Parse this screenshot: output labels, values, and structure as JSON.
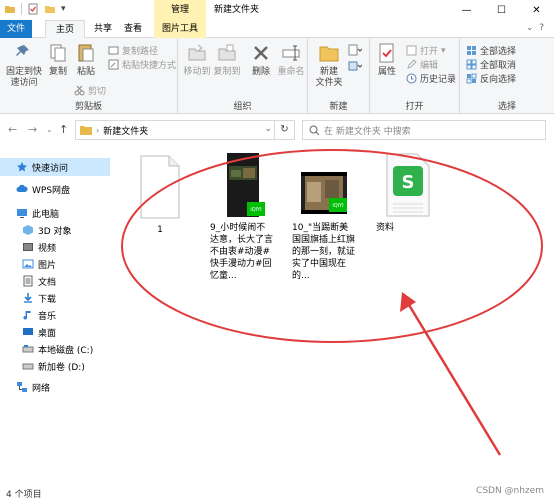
{
  "window": {
    "title": "新建文件夹",
    "manage_tab": "管理",
    "minimize": "—",
    "maximize": "☐",
    "close": "✕"
  },
  "tabs": {
    "file": "文件",
    "home": "主页",
    "share": "共享",
    "view": "查看",
    "picture_tools": "图片工具"
  },
  "ribbon": {
    "pin_quick_access": "固定到快\n速访问",
    "copy": "复制",
    "paste": "粘贴",
    "copy_path": "复制路径",
    "paste_shortcut": "粘贴快捷方式",
    "cut": "剪切",
    "clipboard": "剪贴板",
    "move_to": "移动到",
    "copy_to": "复制到",
    "delete": "删除",
    "rename": "重命名",
    "organize": "组织",
    "new_folder": "新建\n文件夹",
    "new": "新建",
    "properties": "属性",
    "open": "打开",
    "edit": "编辑",
    "history": "历史记录",
    "open_group": "打开",
    "select_all": "全部选择",
    "select_none": "全部取消",
    "invert_selection": "反向选择",
    "select": "选择"
  },
  "address": {
    "path": "新建文件夹",
    "search_placeholder": "在 新建文件夹 中搜索"
  },
  "nav": {
    "quick_access": "快速访问",
    "wps": "WPS网盘",
    "this_pc": "此电脑",
    "objects3d": "3D 对象",
    "videos": "视频",
    "pictures": "图片",
    "documents": "文档",
    "downloads": "下载",
    "music": "音乐",
    "desktop": "桌面",
    "local_disk": "本地磁盘 (C:)",
    "new_volume": "新加卷 (D:)",
    "network": "网络"
  },
  "files": [
    {
      "name": "1"
    },
    {
      "name": "9_小时候闹不达意，长大了言不由衷#动漫#快手漫动力#回忆童..."
    },
    {
      "name": "10_\"当踢断美国国旗插上红旗的那一刻，就证实了中国现在的..."
    },
    {
      "name": "资料"
    }
  ],
  "badges": {
    "iqiyi": "iQIYI"
  },
  "status": {
    "count": "4 个项目",
    "watermark": "CSDN @nhzem"
  },
  "colors": {
    "accent": "#1979ca",
    "annotation": "#e03c3c",
    "selection": "#cce8ff"
  }
}
